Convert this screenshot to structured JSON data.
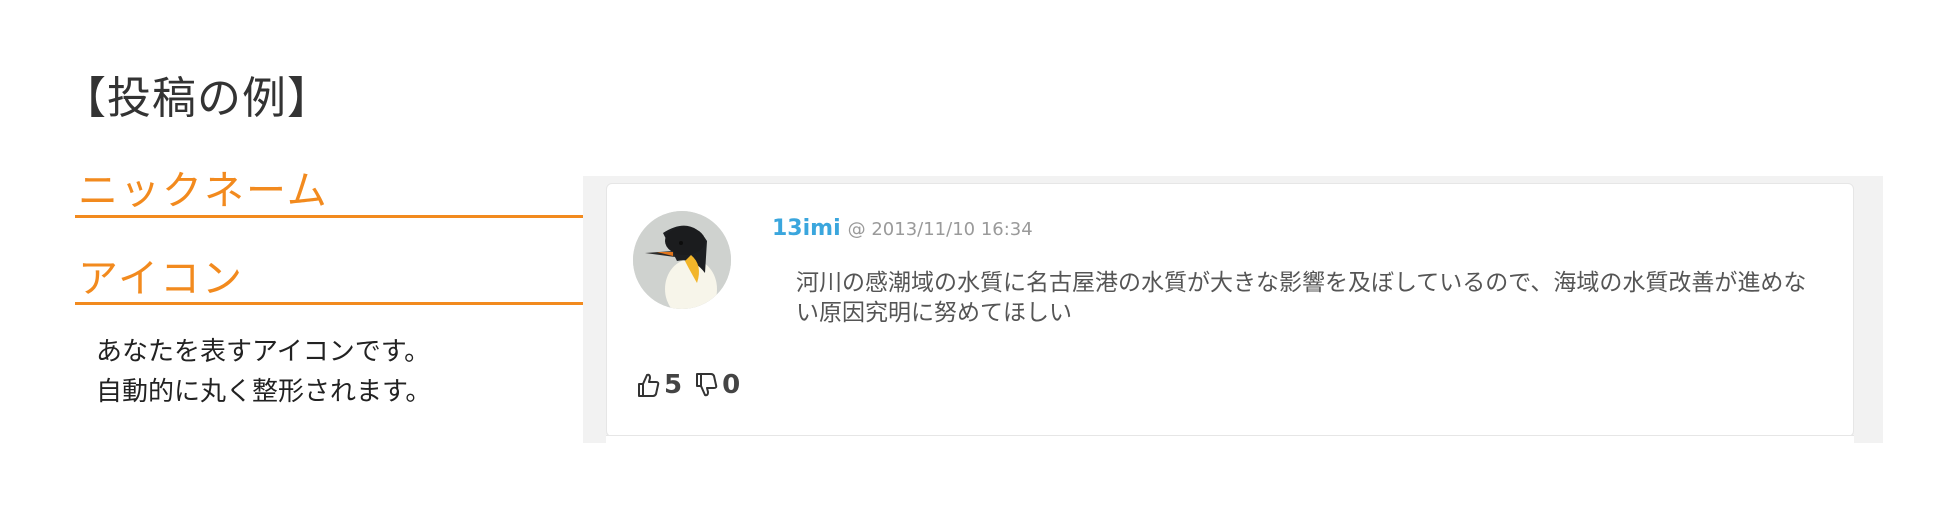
{
  "title": "【投稿の例】",
  "labels": {
    "nickname": "ニックネーム",
    "icon": "アイコン"
  },
  "description": {
    "line1": "あなたを表すアイコンです。",
    "line2": "自動的に丸く整形されます。"
  },
  "post": {
    "nickname": "13imi",
    "date": "@ 2013/11/10 16:34",
    "body": "河川の感潮域の水質に名古屋港の水質が大きな影響を及ぼしているので、海域の水質改善が進めない原因究明に努めてほしい",
    "likes": "5",
    "dislikes": "0"
  },
  "colors": {
    "accent": "#f28a1e",
    "nickname": "#3aa6dd"
  },
  "icons": [
    "thumbs-up-icon",
    "thumbs-down-icon"
  ]
}
